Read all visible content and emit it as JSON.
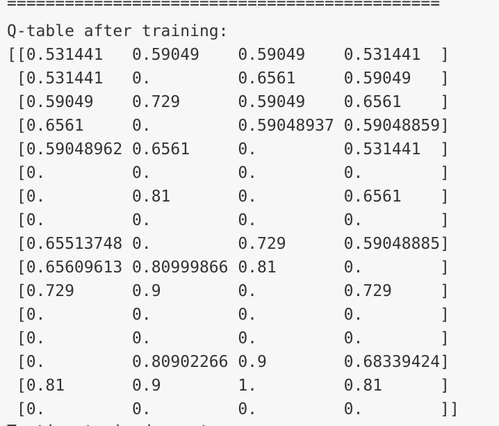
{
  "output": {
    "separator": "=============================================",
    "heading": "Q-table after training:",
    "rows": [
      "[[0.531441   0.59049    0.59049    0.531441  ]",
      " [0.531441   0.         0.6561     0.59049   ]",
      " [0.59049    0.729      0.59049    0.6561    ]",
      " [0.6561     0.         0.59048937 0.59048859]",
      " [0.59048962 0.6561     0.         0.531441  ]",
      " [0.         0.         0.         0.        ]",
      " [0.         0.81       0.         0.6561    ]",
      " [0.         0.         0.         0.        ]",
      " [0.65513748 0.         0.729      0.59048885]",
      " [0.65609613 0.80999866 0.81       0.        ]",
      " [0.729      0.9        0.         0.729     ]",
      " [0.         0.         0.         0.        ]",
      " [0.         0.         0.         0.        ]",
      " [0.         0.80902266 0.9        0.68339424]",
      " [0.81       0.9        1.         0.81      ]",
      " [0.         0.         0.         0.        ]]"
    ],
    "cut_off_line": "Testing trained agent..."
  }
}
